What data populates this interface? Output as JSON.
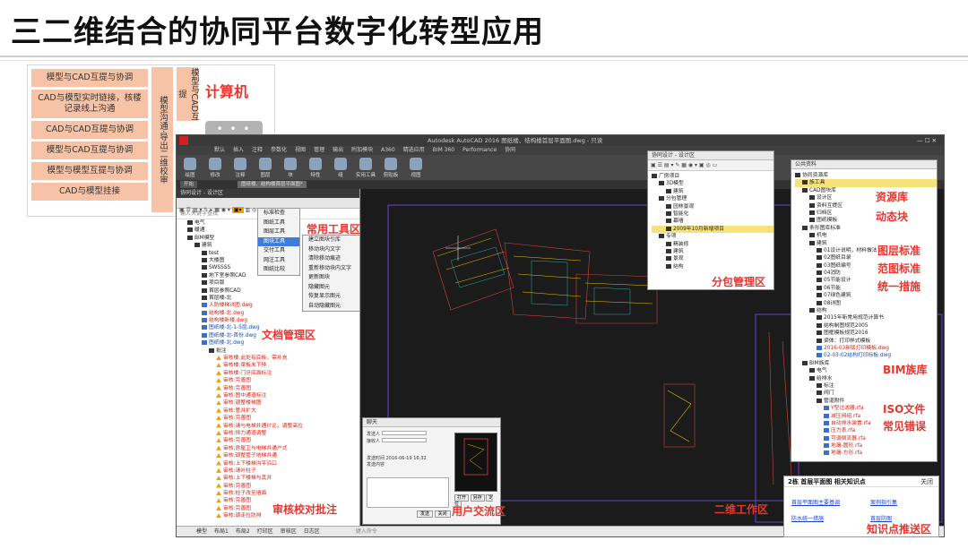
{
  "slide": {
    "title": "三二维结合的协同平台数字化转型应用"
  },
  "left_panel": {
    "cards": [
      "模型与CAD互提与协调",
      "CAD与模型实时链接，核楼记录线上沟通",
      "CAD与CAD互提与协调",
      "模型与CAD互提与协调",
      "模型与模型互提与协调",
      "CAD与模型挂接"
    ],
    "vertical1": "模型沟通·导出二维校审",
    "vertical2": "模型与CAD互提",
    "calc_title": "计算机",
    "calc_dots": "• • •"
  },
  "cad": {
    "window_title": "Autodesk AutoCAD 2016  图纸楼、结构楼首层平面图.dwg - 只读",
    "menu_items": [
      "默认",
      "插入",
      "注释",
      "参数化",
      "视图",
      "管理",
      "输出",
      "附加模块",
      "A360",
      "精选应用",
      "BIM 360",
      "Performance",
      "协同"
    ],
    "ribbon_buttons": [
      "绘图",
      "修改",
      "注释",
      "图层",
      "块",
      "特性",
      "组",
      "实用工具",
      "剪贴板",
      "视图"
    ],
    "doc_tabs": [
      "开始",
      "图纸楼、结构楼首层平面图*"
    ],
    "search_placeholder": "输入关键字查找",
    "panel_title": "协同设计 - 设计区",
    "statusbar_items": [
      "模型",
      "布局1",
      "布局2",
      "打印区",
      "审核区",
      "日志区"
    ],
    "command_placeholder": "键入命令"
  },
  "doc_tree": [
    {
      "t": "电气",
      "c": "n",
      "i": "f",
      "lv": 1
    },
    {
      "t": "暖通",
      "c": "n",
      "i": "f",
      "lv": 1
    },
    {
      "t": "BIM模型",
      "c": "n",
      "i": "f",
      "lv": 1
    },
    {
      "t": "建筑",
      "c": "n",
      "i": "f",
      "lv": 2
    },
    {
      "t": "test",
      "c": "n",
      "i": "f",
      "lv": 3
    },
    {
      "t": "大楼图",
      "c": "n",
      "i": "f",
      "lv": 3
    },
    {
      "t": "SWSSSS",
      "c": "n",
      "i": "f",
      "lv": 3
    },
    {
      "t": "地下室参照CAD",
      "c": "n",
      "i": "f",
      "lv": 3
    },
    {
      "t": "项目版",
      "c": "n",
      "i": "f",
      "lv": 3
    },
    {
      "t": "首层参照CAD",
      "c": "n",
      "i": "f",
      "lv": 3
    },
    {
      "t": "首层楼-北",
      "c": "n",
      "i": "f",
      "lv": 3
    },
    {
      "t": "人防楼梯详图.dwg",
      "c": "r",
      "i": "d",
      "lv": 3
    },
    {
      "t": "结构楼-北.dwg",
      "c": "r",
      "i": "d",
      "lv": 3
    },
    {
      "t": "结构楼新楼.dwg",
      "c": "r",
      "i": "d",
      "lv": 3
    },
    {
      "t": "图纸楼-北-1-5层.dwg",
      "c": "b",
      "i": "d",
      "lv": 3
    },
    {
      "t": "图纸楼-北-首份.dwg",
      "c": "b",
      "i": "d",
      "lv": 3
    },
    {
      "t": "图纸楼-北.dwg",
      "c": "b",
      "i": "d",
      "lv": 3
    },
    {
      "t": "批注",
      "c": "n",
      "i": "f",
      "lv": 4
    },
    {
      "t": "审核楼:此处有底板，需补充",
      "c": "r",
      "i": "w",
      "lv": 5
    },
    {
      "t": "审核楼:梁板未下移",
      "c": "r",
      "i": "w",
      "lv": 5
    },
    {
      "t": "审核楼:门牙底面标注",
      "c": "r",
      "i": "w",
      "lv": 5
    },
    {
      "t": "审核:完善图",
      "c": "r",
      "i": "w",
      "lv": 5
    },
    {
      "t": "审核:完善图",
      "c": "r",
      "i": "w",
      "lv": 5
    },
    {
      "t": "审核:图中通道标注",
      "c": "r",
      "i": "w",
      "lv": 5
    },
    {
      "t": "审核:调整楼梯图",
      "c": "r",
      "i": "w",
      "lv": 5
    },
    {
      "t": "审核:管井扩大",
      "c": "r",
      "i": "w",
      "lv": 5
    },
    {
      "t": "审核:完善图",
      "c": "r",
      "i": "w",
      "lv": 5
    },
    {
      "t": "审核:请与电梯井通讨论，调整高位",
      "c": "r",
      "i": "w",
      "lv": 5
    },
    {
      "t": "审核:恒力通道调整",
      "c": "r",
      "i": "w",
      "lv": 5
    },
    {
      "t": "审核:完善图",
      "c": "r",
      "i": "w",
      "lv": 5
    },
    {
      "t": "审核:房屋卫与电梯井通户式",
      "c": "r",
      "i": "w",
      "lv": 5
    },
    {
      "t": "审核:调整管子地梯井通",
      "c": "r",
      "i": "w",
      "lv": 5
    },
    {
      "t": "审核:上下楼梯沟平沿口",
      "c": "r",
      "i": "w",
      "lv": 5
    },
    {
      "t": "审核:请补柱子",
      "c": "r",
      "i": "w",
      "lv": 5
    },
    {
      "t": "审核:上下楼梯与其井",
      "c": "r",
      "i": "w",
      "lv": 5
    },
    {
      "t": "审核:完善图",
      "c": "r",
      "i": "w",
      "lv": 5
    },
    {
      "t": "审核:检子改至墙面",
      "c": "r",
      "i": "w",
      "lv": 5
    },
    {
      "t": "审核:完善图",
      "c": "r",
      "i": "w",
      "lv": 5
    },
    {
      "t": "审核:完善图",
      "c": "r",
      "i": "w",
      "lv": 5
    },
    {
      "t": "审核:调走位防排",
      "c": "r",
      "i": "w",
      "lv": 5
    }
  ],
  "menus": {
    "main": [
      "标准检查",
      "图纸工具",
      "图层工具",
      "图块工具",
      "交付工具",
      "网注工具",
      "图纸比较"
    ],
    "sub": [
      "建立图块引库",
      "移动块内文字",
      "清除移动痕迹",
      "重新移动块内文字",
      "更新图块",
      "隐藏图元",
      "恢复显示图元",
      "自动隐藏图元"
    ],
    "selected_main": 3
  },
  "subcontract_panel": {
    "title": "协同设计 - 设计区",
    "items": [
      {
        "t": "厂房项目",
        "lv": 0
      },
      {
        "t": "3D模型",
        "lv": 1
      },
      {
        "t": "建筑",
        "lv": 2
      },
      {
        "t": "分包管理",
        "lv": 1
      },
      {
        "t": "园林景观",
        "lv": 2
      },
      {
        "t": "智能化",
        "lv": 2
      },
      {
        "t": "幕墙",
        "lv": 2
      },
      {
        "t": "2009年10月新增项目",
        "lv": 2,
        "hl": true
      },
      {
        "t": "专项",
        "lv": 1
      },
      {
        "t": "精装修",
        "lv": 2
      },
      {
        "t": "建筑",
        "lv": 2
      },
      {
        "t": "景观",
        "lv": 2
      },
      {
        "t": "结构",
        "lv": 2
      }
    ]
  },
  "resource_panel": {
    "title": "公共资料",
    "items": [
      {
        "t": "协同资源库",
        "lv": 0,
        "c": "n"
      },
      {
        "t": "族工具",
        "lv": 1,
        "c": "hl"
      },
      {
        "t": "CAD图块库",
        "lv": 1,
        "c": "n"
      },
      {
        "t": "设计区",
        "lv": 2,
        "c": "n"
      },
      {
        "t": "资料互提区",
        "lv": 2,
        "c": "n"
      },
      {
        "t": "归档区",
        "lv": 2,
        "c": "n"
      },
      {
        "t": "图纸模板",
        "lv": 2,
        "c": "n"
      },
      {
        "t": "条形图库标准",
        "lv": 1,
        "c": "n"
      },
      {
        "t": "机电",
        "lv": 2,
        "c": "n"
      },
      {
        "t": "建筑",
        "lv": 2,
        "c": "n"
      },
      {
        "t": "01设计说明，材料做法",
        "lv": 3,
        "c": "n"
      },
      {
        "t": "02图纸目录",
        "lv": 3,
        "c": "n"
      },
      {
        "t": "03图纸编号",
        "lv": 3,
        "c": "n"
      },
      {
        "t": "04消防",
        "lv": 3,
        "c": "n"
      },
      {
        "t": "05节能设计",
        "lv": 3,
        "c": "n"
      },
      {
        "t": "06节能",
        "lv": 3,
        "c": "n"
      },
      {
        "t": "07绿色建筑",
        "lv": 3,
        "c": "n"
      },
      {
        "t": "08详图",
        "lv": 3,
        "c": "n"
      },
      {
        "t": "结构",
        "lv": 2,
        "c": "n"
      },
      {
        "t": "2015年新常用规范计算书",
        "lv": 3,
        "c": "n"
      },
      {
        "t": "结构制图规范2005",
        "lv": 3,
        "c": "n"
      },
      {
        "t": "图框模板规范2016",
        "lv": 3,
        "c": "n"
      },
      {
        "t": "梁体：打印样式模板",
        "lv": 3,
        "c": "n"
      },
      {
        "t": "2016-03新版打印模板.dwg",
        "lv": 3,
        "c": "r"
      },
      {
        "t": "02-03-02结构打印标板.dwg",
        "lv": 3,
        "c": "b"
      },
      {
        "t": "BIM族库",
        "lv": 1,
        "c": "n"
      },
      {
        "t": "电气",
        "lv": 2,
        "c": "n"
      },
      {
        "t": "给排水",
        "lv": 2,
        "c": "n"
      },
      {
        "t": "标注",
        "lv": 3,
        "c": "n"
      },
      {
        "t": "阀门",
        "lv": 3,
        "c": "n"
      },
      {
        "t": "管道附件",
        "lv": 3,
        "c": "n"
      },
      {
        "t": "Y型过滤器.rfa",
        "lv": 4,
        "c": "r"
      },
      {
        "t": "减压阀组.rfa",
        "lv": 4,
        "c": "r"
      },
      {
        "t": "自动排水装置.rfa",
        "lv": 4,
        "c": "r"
      },
      {
        "t": "压力表.rfa",
        "lv": 4,
        "c": "r"
      },
      {
        "t": "可调倒流器.rfa",
        "lv": 4,
        "c": "r"
      },
      {
        "t": "地漏-圆形.rfa",
        "lv": 4,
        "c": "r"
      },
      {
        "t": "地漏-方形.rfa",
        "lv": 4,
        "c": "r"
      }
    ]
  },
  "chat_dialog": {
    "title": "聊天",
    "fields": [
      "发送人",
      "接收人",
      "发送内容"
    ],
    "time_text": "发送时间 2016-06-19 16:32",
    "buttons": [
      "发送",
      "关闭",
      "截图"
    ],
    "thumb_buttons": [
      "打开",
      "另存",
      "定位"
    ]
  },
  "knowledge_box": {
    "header": "2栋  首层平面图  相关知识点",
    "close": "关闭",
    "links": [
      "首层平面图主要基调",
      "案例指引集",
      "防水统一措施",
      "首层防图"
    ]
  },
  "labels": {
    "tools": "常用工具区",
    "docs": "文档管理区",
    "review": "审核校对批注",
    "chat": "用户交流区",
    "work": "二维工作区",
    "subcontract": "分包管理区",
    "resource": "资源库",
    "dynblock": "动态块",
    "layers": "图层标准",
    "frame": "范图标准",
    "unify": "统一措施",
    "bim": "BIM族库",
    "iso": "ISO文件",
    "errors": "常见错误",
    "knowledge": "知识点推送区"
  }
}
